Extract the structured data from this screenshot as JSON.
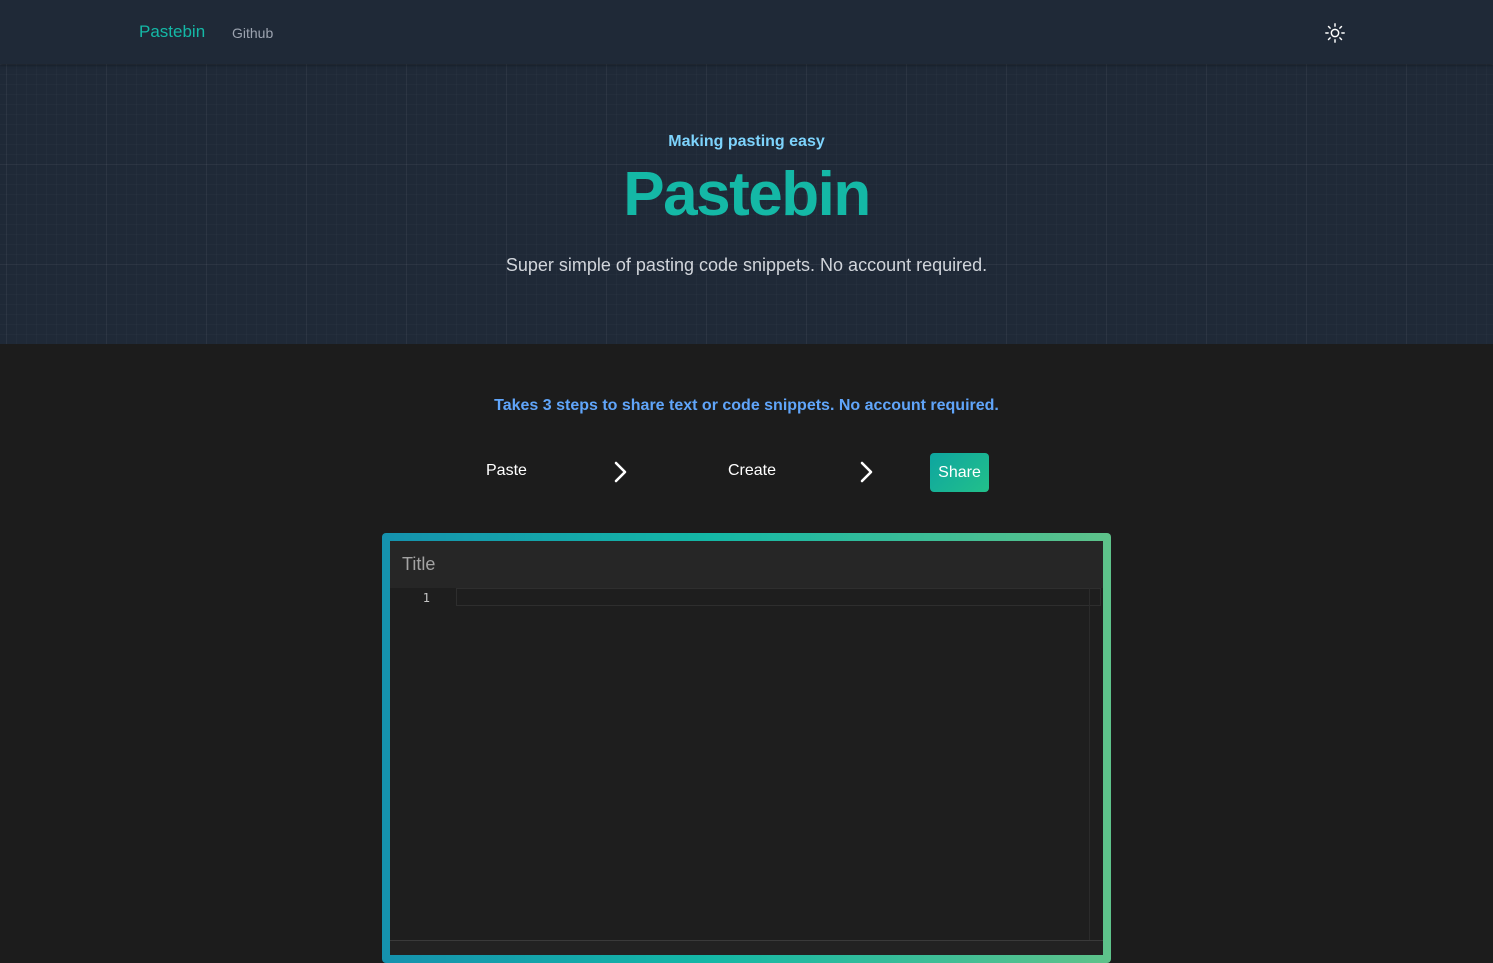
{
  "nav": {
    "brand": "Pastebin",
    "links": [
      "Github"
    ],
    "theme_toggle_icon": "sun-icon"
  },
  "hero": {
    "eyebrow": "Making pasting easy",
    "title": "Pastebin",
    "subtitle": "Super simple of pasting code snippets. No account required."
  },
  "steps": {
    "heading": "Takes 3 steps to share text or code snippets. No account required.",
    "items": [
      "Paste",
      "Create"
    ],
    "share_label": "Share",
    "separator_icon": "chevron-right-icon"
  },
  "editor": {
    "title_placeholder": "Title",
    "line_numbers": [
      "1"
    ]
  },
  "colors": {
    "accent": "#14b8a6",
    "eyebrow": "#7dd3fc",
    "steps_heading": "#60a5fa",
    "navbar_bg": "#1f2937",
    "page_bg": "#1c1c1c",
    "editor_bg": "#1e1e1e"
  }
}
